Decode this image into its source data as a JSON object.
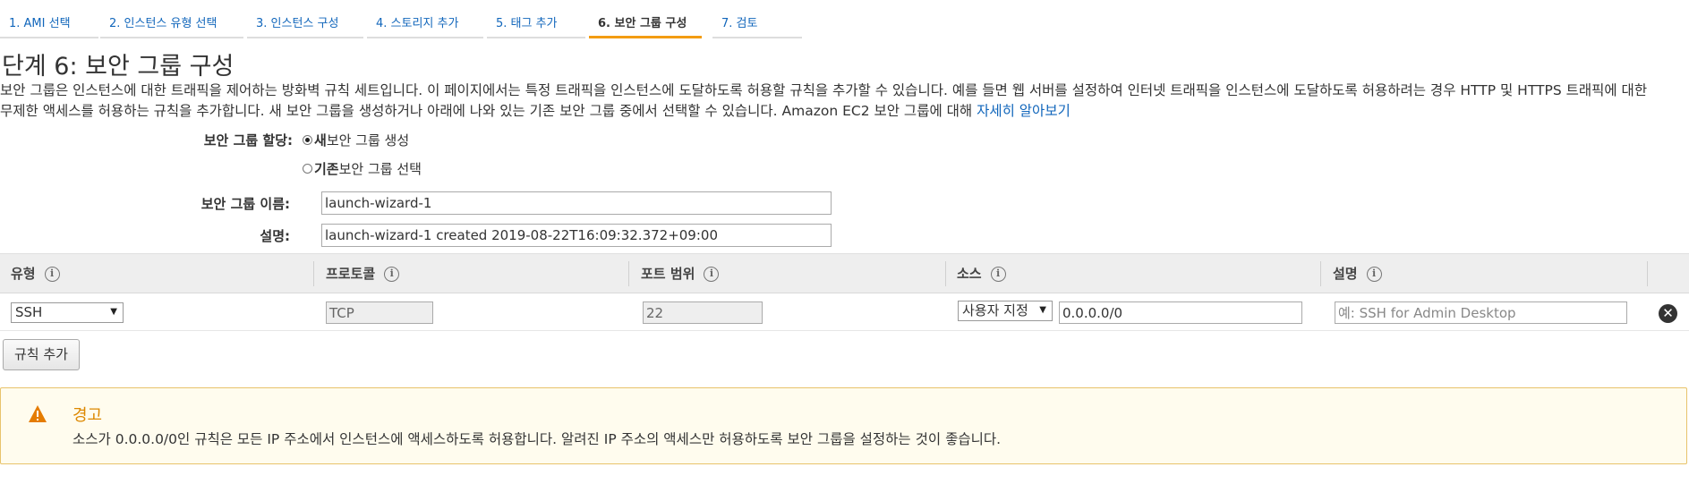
{
  "tabs": [
    {
      "label": "1. AMI 선택"
    },
    {
      "label": "2. 인스턴스 유형 선택"
    },
    {
      "label": "3. 인스턴스 구성"
    },
    {
      "label": "4. 스토리지 추가"
    },
    {
      "label": "5. 태그 추가"
    },
    {
      "label": "6. 보안 그룹 구성"
    },
    {
      "label": "7. 검토"
    }
  ],
  "page": {
    "title": "단계 6: 보안 그룹 구성",
    "intro": "보안 그룹은 인스턴스에 대한 트래픽을 제어하는 방화벽 규칙 세트입니다. 이 페이지에서는 특정 트래픽을 인스턴스에 도달하도록 허용할 규칙을 추가할 수 있습니다. 예를 들면 웹 서버를 설정하여 인터넷 트래픽을 인스턴스에 도달하도록 허용하려는 경우 HTTP 및 HTTPS 트래픽에 대한 무제한 액세스를 허용하는 규칙을 추가합니다. 새 보안 그룹을 생성하거나 아래에 나와 있는 기존 보안 그룹 중에서 선택할 수 있습니다. Amazon EC2 보안 그룹에 대해 ",
    "learn_more": "자세히 알아보기"
  },
  "form": {
    "assign_label": "보안 그룹 할당:",
    "option_new_bold": "새",
    "option_new_rest": " 보안 그룹 생성",
    "option_existing_bold": "기존",
    "option_existing_rest": " 보안 그룹 선택",
    "name_label": "보안 그룹 이름:",
    "name_value": "launch-wizard-1",
    "desc_label": "설명:",
    "desc_value": "launch-wizard-1 created 2019-08-22T16:09:32.372+09:00"
  },
  "table": {
    "headers": {
      "type": "유형",
      "protocol": "프로토콜",
      "port_range": "포트 범위",
      "source": "소스",
      "description": "설명"
    },
    "row": {
      "type": "SSH",
      "protocol": "TCP",
      "port": "22",
      "source_select": "사용자 지정",
      "source_cidr": "0.0.0.0/0",
      "description_placeholder": "예: SSH for Admin Desktop"
    },
    "add_rule_label": "규칙 추가"
  },
  "warning": {
    "title": "경고",
    "message": "소스가 0.0.0.0/0인 규칙은 모든 IP 주소에서 인스턴스에 액세스하도록 허용합니다. 알려진 IP 주소의 액세스만 허용하도록 보안 그룹을 설정하는 것이 좋습니다."
  },
  "icons": {
    "info": "i",
    "remove": "✕",
    "dropdown": "▼"
  },
  "colors": {
    "link": "#1166bb",
    "active_tab_underline": "#f39c12",
    "warning_title": "#dd8800",
    "warning_bg": "#fffcee"
  }
}
